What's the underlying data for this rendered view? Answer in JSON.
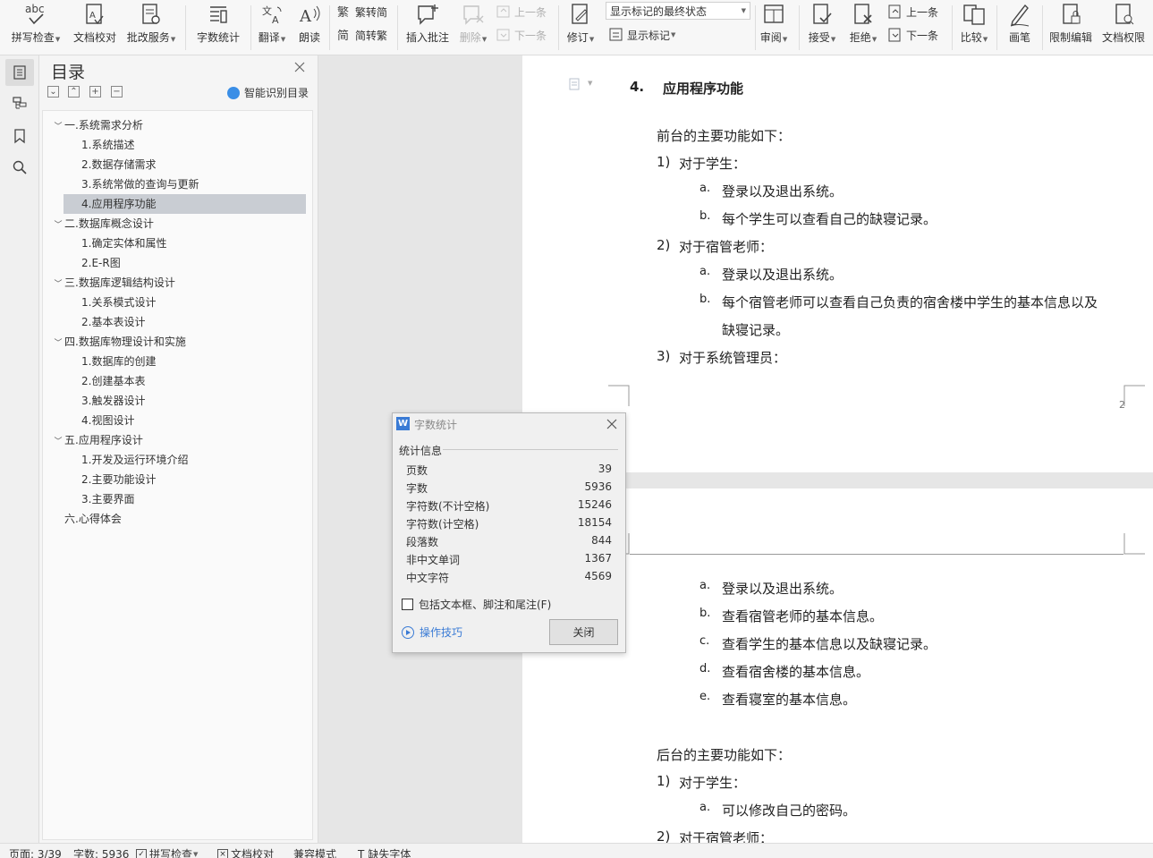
{
  "ribbon": {
    "spell_check": "拼写检查",
    "doc_proof": "文档校对",
    "annotate_service": "批改服务",
    "word_count": "字数统计",
    "translate": "翻译",
    "read_aloud": "朗读",
    "trad_to_simp": "繁转简",
    "simp_to_trad": "简转繁",
    "insert_comment": "插入批注",
    "delete": "删除",
    "prev_comment": "上一条",
    "next_comment": "下一条",
    "revise": "修订",
    "markup_state": "显示标记的最终状态",
    "show_markup": "显示标记",
    "review": "审阅",
    "accept": "接受",
    "reject": "拒绝",
    "prev_change": "上一条",
    "next_change": "下一条",
    "compare": "比较",
    "pen": "画笔",
    "restrict_edit": "限制编辑",
    "doc_permission": "文档权限"
  },
  "toc": {
    "title": "目录",
    "smart_toc": "智能识别目录",
    "items": [
      {
        "label": "一.系统需求分析",
        "level": 1,
        "expanded": true
      },
      {
        "label": "1.系统描述",
        "level": 2
      },
      {
        "label": "2.数据存储需求",
        "level": 2
      },
      {
        "label": "3.系统常做的查询与更新",
        "level": 2
      },
      {
        "label": "4.应用程序功能",
        "level": 2,
        "selected": true
      },
      {
        "label": "二.数据库概念设计",
        "level": 1,
        "expanded": true
      },
      {
        "label": "1.确定实体和属性",
        "level": 2
      },
      {
        "label": "2.E-R图",
        "level": 2
      },
      {
        "label": "三.数据库逻辑结构设计",
        "level": 1,
        "expanded": true
      },
      {
        "label": "1.关系模式设计",
        "level": 2
      },
      {
        "label": "2.基本表设计",
        "level": 2
      },
      {
        "label": "四.数据库物理设计和实施",
        "level": 1,
        "expanded": true
      },
      {
        "label": "1.数据库的创建",
        "level": 2
      },
      {
        "label": "2.创建基本表",
        "level": 2
      },
      {
        "label": "3.触发器设计",
        "level": 2
      },
      {
        "label": "4.视图设计",
        "level": 2
      },
      {
        "label": "五.应用程序设计",
        "level": 1,
        "expanded": true
      },
      {
        "label": "1.开发及运行环境介绍",
        "level": 2
      },
      {
        "label": "2.主要功能设计",
        "level": 2
      },
      {
        "label": "3.主要界面",
        "level": 2
      },
      {
        "label": "六.心得体会",
        "level": 1
      }
    ]
  },
  "document": {
    "heading_num": "4.",
    "heading_text": "应用程序功能",
    "page_number": "2",
    "page1": [
      {
        "marker": "",
        "text": "前台的主要功能如下："
      },
      {
        "marker": "1)",
        "text": "对于学生："
      },
      {
        "marker": "a.",
        "text": "登录以及退出系统。"
      },
      {
        "marker": "b.",
        "text": "每个学生可以查看自己的缺寝记录。"
      },
      {
        "marker": "2)",
        "text": "对于宿管老师："
      },
      {
        "marker": "a.",
        "text": "登录以及退出系统。"
      },
      {
        "marker": "b.",
        "text": "每个宿管老师可以查看自己负责的宿舍楼中学生的基本信息以及"
      },
      {
        "marker": "",
        "text": "缺寝记录。"
      },
      {
        "marker": "3)",
        "text": "对于系统管理员："
      }
    ],
    "page2": [
      {
        "marker": "a.",
        "text": "登录以及退出系统。"
      },
      {
        "marker": "b.",
        "text": "查看宿管老师的基本信息。"
      },
      {
        "marker": "c.",
        "text": "查看学生的基本信息以及缺寝记录。"
      },
      {
        "marker": "d.",
        "text": "查看宿舍楼的基本信息。"
      },
      {
        "marker": "e.",
        "text": "查看寝室的基本信息。"
      },
      {
        "marker": "",
        "text": "后台的主要功能如下："
      },
      {
        "marker": "1)",
        "text": "对于学生："
      },
      {
        "marker": "a.",
        "text": "可以修改自己的密码。"
      },
      {
        "marker": "2)",
        "text": "对于宿管老师："
      }
    ]
  },
  "dialog": {
    "title": "字数统计",
    "icon_letter": "W",
    "section": "统计信息",
    "stats": [
      {
        "label": "页数",
        "value": "39"
      },
      {
        "label": "字数",
        "value": "5936"
      },
      {
        "label": "字符数(不计空格)",
        "value": "15246"
      },
      {
        "label": "字符数(计空格)",
        "value": "18154"
      },
      {
        "label": "段落数",
        "value": "844"
      },
      {
        "label": "非中文单词",
        "value": "1367"
      },
      {
        "label": "中文字符",
        "value": "4569"
      }
    ],
    "include_label": "包括文本框、脚注和尾注(F)",
    "tips": "操作技巧",
    "close": "关闭"
  },
  "status": {
    "page": "页面: 3/39",
    "words": "字数: 5936",
    "spell": "拼写检查",
    "proof": "文档校对",
    "compat": "兼容模式",
    "missing_font": "缺失字体"
  },
  "colors": {
    "accent": "#3a7bd5",
    "selected_toc": "#c9cdd3"
  }
}
